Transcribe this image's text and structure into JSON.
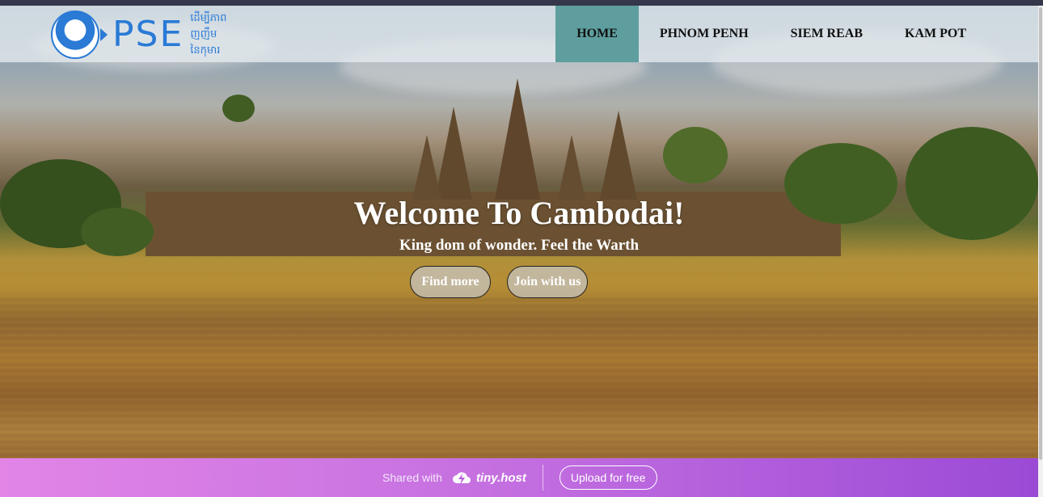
{
  "site": {
    "logo_text": "PSE",
    "logo_subtitle_lines": [
      "ដើម្បីភាព",
      "ញញឹម",
      "នៃកុមារ"
    ]
  },
  "nav": {
    "items": [
      {
        "label": "HOME",
        "active": true
      },
      {
        "label": "PHNOM PENH",
        "active": false
      },
      {
        "label": "SIEM REAB",
        "active": false
      },
      {
        "label": "KAM POT",
        "active": false
      }
    ],
    "active_color": "#5f9e9e"
  },
  "hero": {
    "title": "Welcome To Cambodai!",
    "subtitle": "King dom of wonder. Feel the Warth",
    "buttons": [
      "Find more",
      "Join with us"
    ]
  },
  "footer_banner": {
    "shared_text": "Shared with",
    "brand": "tiny.host",
    "cta": "Upload for free"
  },
  "colors": {
    "logo_blue": "#2a7ad6",
    "banner_start": "#e285e7",
    "banner_end": "#9b4ad6"
  }
}
